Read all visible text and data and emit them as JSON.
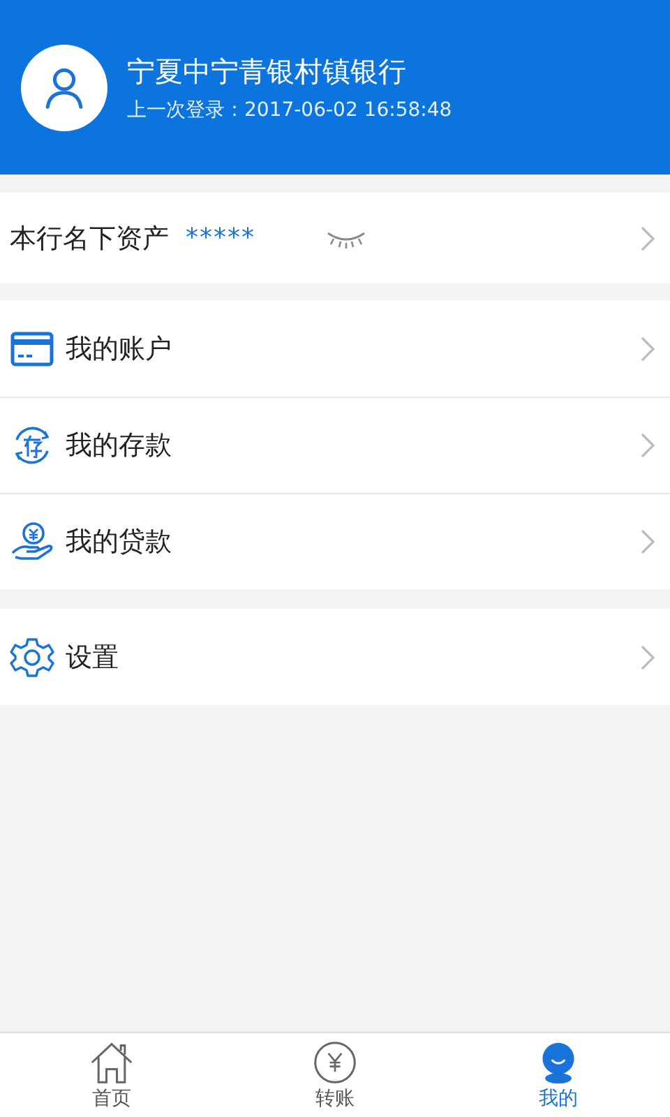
{
  "profile": {
    "bank_name": "宁夏中宁青银村镇银行",
    "last_login": "上一次登录：2017-06-02 16:58:48"
  },
  "assets": {
    "label": "本行名下资产",
    "value": "*****"
  },
  "menu_groups": [
    [
      {
        "kind": "card",
        "label": "我的账户"
      },
      {
        "kind": "deposit",
        "label": "我的存款"
      },
      {
        "kind": "loan",
        "label": "我的贷款"
      }
    ],
    [
      {
        "kind": "settings",
        "label": "设置"
      }
    ]
  ],
  "tabs": [
    {
      "kind": "home",
      "label": "首页",
      "selected": false
    },
    {
      "kind": "transfer",
      "label": "转账",
      "selected": false
    },
    {
      "kind": "me",
      "label": "我的",
      "selected": true
    }
  ]
}
